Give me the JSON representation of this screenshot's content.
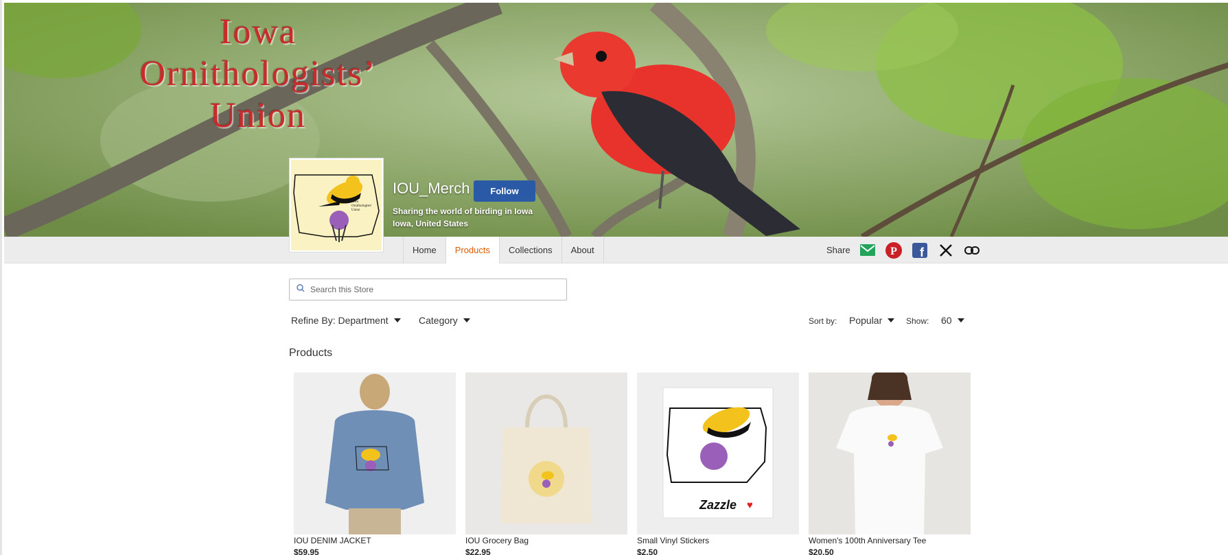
{
  "banner": {
    "title_line1": "Iowa",
    "title_line2": "Ornithologists’",
    "title_line3": "Union"
  },
  "store": {
    "name": "IOU_Merch",
    "follow_label": "Follow",
    "tagline": "Sharing the world of birding in Iowa",
    "location": "Iowa, United States",
    "avatar_text": "Iowa Ornithologists' Union"
  },
  "nav": {
    "tabs": [
      {
        "label": "Home"
      },
      {
        "label": "Products"
      },
      {
        "label": "Collections"
      },
      {
        "label": "About"
      }
    ],
    "active_tab": "Products",
    "share_label": "Share",
    "share_icons": [
      "email-icon",
      "pinterest-icon",
      "facebook-icon",
      "x-icon",
      "link-icon"
    ]
  },
  "search": {
    "placeholder": "Search this Store"
  },
  "filters": {
    "department": "Refine By: Department",
    "category": "Category",
    "sort_label": "Sort by:",
    "sort_value": "Popular",
    "show_label": "Show:",
    "show_value": "60"
  },
  "products_title": "Products",
  "products": [
    {
      "name": "IOU DENIM JACKET",
      "price": "$59.95"
    },
    {
      "name": "IOU Grocery Bag",
      "price": "$22.95"
    },
    {
      "name": "Small Vinyl Stickers",
      "price": "$2.50",
      "badge": "Zazzle"
    },
    {
      "name": "Women's 100th Anniversary Tee",
      "price": "$20.50"
    }
  ],
  "colors": {
    "accent": "#e05a00",
    "follow": "#2a5aa5",
    "banner_title": "#c92b2b"
  }
}
